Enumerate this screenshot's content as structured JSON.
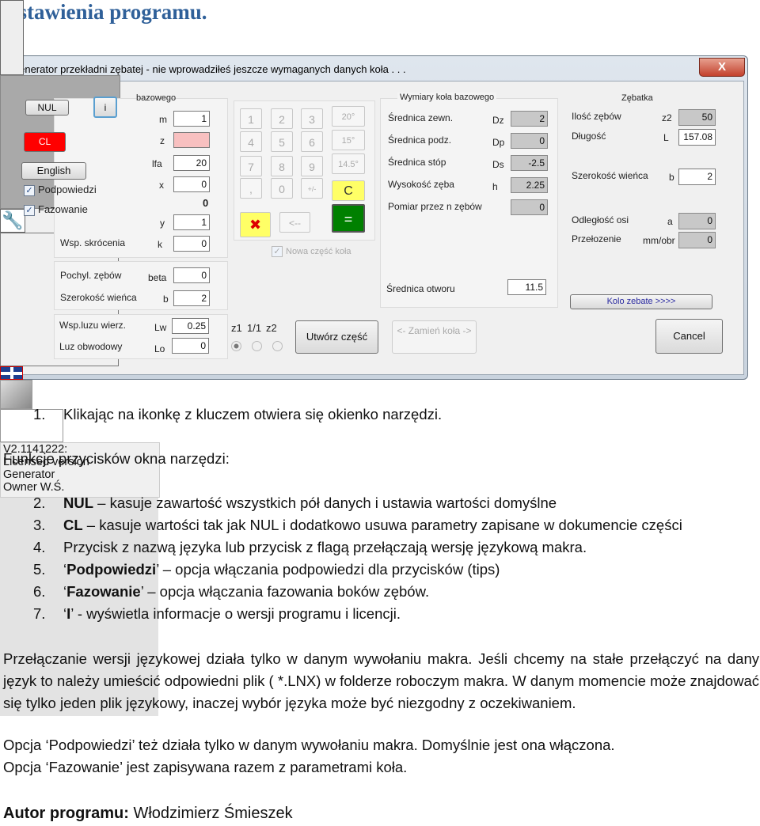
{
  "heading": "Ustawienia programu.",
  "dialog": {
    "title": "Generator przekładni zębatej  -  nie wprowadziłeś jeszcze wymaganych danych koła . . .",
    "close_label": "X",
    "toolbox": {
      "nul": "NUL",
      "info": "i",
      "cl": "CL",
      "english": "English",
      "flag_icon": "uk-flag-icon",
      "tips_label": "Podpowiedzi",
      "tips_checked": true,
      "chamfer_label": "Fazowanie",
      "chamfer_checked": true,
      "cl_color": "#ff0000"
    },
    "left": {
      "group_title": "bazowego",
      "rows": [
        {
          "sym": "m",
          "value": "1"
        },
        {
          "sym": "z",
          "value": ""
        },
        {
          "sym": "lfa",
          "value": "20"
        },
        {
          "sym": "x",
          "value": "0"
        },
        {
          "sym": "y",
          "value": "1"
        },
        {
          "sym": "k",
          "value": "0"
        }
      ],
      "bold_value": "0",
      "skrocenia_label": "Wsp. skrócenia",
      "pochyl_label": "Pochyl. zębów",
      "beta_sym": "beta",
      "beta_value": "0",
      "szer_label": "Szerokość wieńca",
      "b_sym": "b",
      "b_value": "2",
      "lw_label": "Wsp.luzu wierz.",
      "lw_sym": "Lw",
      "lw_value": "0.25",
      "lo_label": "Luz obwodowy",
      "lo_sym": "Lo",
      "lo_value": "0"
    },
    "keypad": {
      "keys": [
        "1",
        "2",
        "3",
        "4",
        "5",
        "6",
        "7",
        "8",
        "9",
        ",",
        "0",
        "+/-"
      ],
      "angles": [
        "20°",
        "15°",
        "14.5°"
      ],
      "clear": "C",
      "back": "<--",
      "equals": "=",
      "clear_color": "#ffff66",
      "equals_color": "#008000"
    },
    "new_part_label": "Nowa część koła",
    "new_part_checked": true,
    "radio": {
      "labels": [
        "z1",
        "1/1",
        "z2"
      ],
      "selected": 0
    },
    "create_button": "Utwórz część",
    "swap_button": "<- Zamień koła ->",
    "cancel_button": "Cancel",
    "dims": {
      "title": "Wymiary koła bazowego",
      "rows": [
        {
          "label": "Średnica zewn.",
          "sym": "Dz",
          "value": "2"
        },
        {
          "label": "Średnica podz.",
          "sym": "Dp",
          "value": "0"
        },
        {
          "label": "Średnica stóp",
          "sym": "Ds",
          "value": "-2.5"
        },
        {
          "label": "Wysokość zęba",
          "sym": "h",
          "value": "2.25"
        },
        {
          "label": "Pomiar przez n zębów",
          "sym": "",
          "value": "0"
        }
      ],
      "info": [
        "V2.1141222:",
        "Licensed version",
        "Generator",
        "Owner W.Ś."
      ],
      "bore_label": "Średnica otworu",
      "bore_value": "11.5"
    },
    "rack": {
      "title": "Zębatka",
      "rows": [
        {
          "label": "Ilość zębów",
          "sym": "z2",
          "value": "50",
          "ro": true
        },
        {
          "label": "Długość",
          "sym": "L",
          "value": "157.08",
          "ro": false
        },
        {
          "label": "Szerokość wieńca",
          "sym": "b",
          "value": "2",
          "ro": false
        },
        {
          "label": "Odległość osi",
          "sym": "a",
          "value": "0",
          "ro": true
        },
        {
          "label": "Przełozenie",
          "sym": "mm/obr",
          "value": "0",
          "ro": true
        }
      ],
      "gear_button": "Kolo zebate >>>>"
    }
  },
  "item1": {
    "num": "1.",
    "text": "Klikając na ikonkę z kluczem otwiera się okienko narzędzi."
  },
  "functions_heading": "Funkcje przycisków okna narzędzi:",
  "items": [
    {
      "num": "2.",
      "bold": "NUL",
      "rest": " – kasuje zawartość wszystkich pół danych i ustawia wartości domyślne"
    },
    {
      "num": "3.",
      "bold": "CL",
      "rest": " – kasuje wartości tak jak NUL i dodatkowo usuwa parametry zapisane w dokumencie części"
    },
    {
      "num": "4.",
      "bold": "",
      "rest": "Przycisk z nazwą języka lub przycisk z flagą przełączają wersję językową makra."
    },
    {
      "num": "5.",
      "pre": "‘",
      "bold": "Podpowiedzi",
      "rest": "’ – opcja włączania podpowiedzi dla przycisków (tips)"
    },
    {
      "num": "6.",
      "pre": "‘",
      "bold": "Fazowanie",
      "rest": "’ – opcja włączania fazowania boków zębów."
    },
    {
      "num": "7.",
      "pre": "‘",
      "bold": "I",
      "rest": "’  -  wyświetla informacje o wersji programu i licencji."
    }
  ],
  "para1": "Przełączanie wersji językowej działa tylko w danym wywołaniu makra. Jeśli chcemy na stałe przełączyć na dany język to należy umieścić odpowiedni plik ( *.LNX) w folderze roboczym makra. W danym momencie może znajdować się tylko jeden plik językowy, inaczej wybór języka może być niezgodny z oczekiwaniem.",
  "para2": "Opcja ‘Podpowiedzi’ też działa tylko w danym wywołaniu makra. Domyślnie jest ona włączona.",
  "para3": "Opcja ‘Fazowanie’  jest zapisywana razem z parametrami koła.",
  "author_label": "Autor programu:",
  "author_name": " Włodzimierz Śmieszek"
}
